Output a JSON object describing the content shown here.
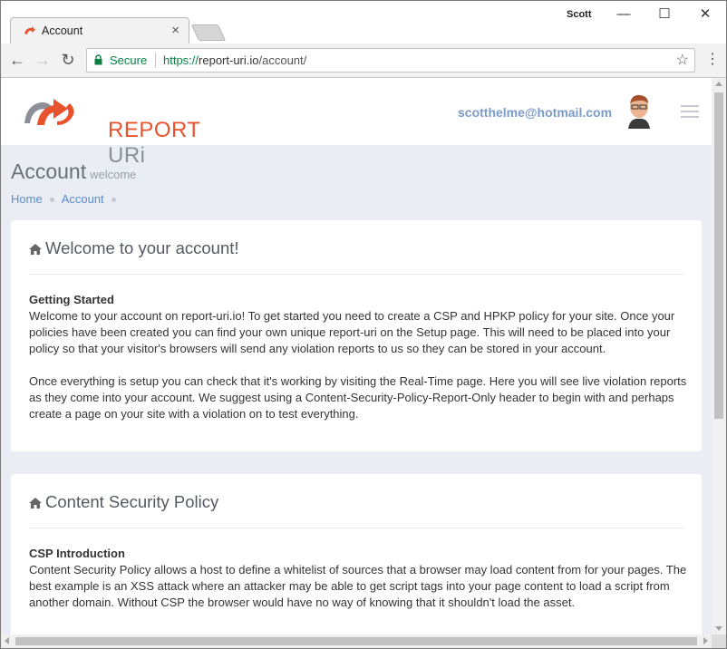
{
  "browser": {
    "tab_title": "Account",
    "tab_close": "×",
    "profile_name": "Scott",
    "minimize": "—",
    "maximize": "☐",
    "close": "✕",
    "secure_label": "Secure",
    "url_scheme": "https://",
    "url_domain": "report-uri.io",
    "url_path": "/account/",
    "back_glyph": "←",
    "forward_glyph": "→",
    "reload_glyph": "↻",
    "star_glyph": "☆",
    "menu_glyph": "⋮"
  },
  "site": {
    "logo_text_1": "REPORT ",
    "logo_text_2": "URi",
    "user_email": "scotthelme@hotmail.com"
  },
  "page": {
    "title": "Account",
    "subtitle": "welcome",
    "breadcrumb": [
      "Home",
      "Account"
    ]
  },
  "cards": [
    {
      "heading": "Welcome to your account!",
      "section_title": "Getting Started",
      "paragraphs": [
        "Welcome to your account on report-uri.io! To get started you need to create a CSP and HPKP policy for your site. Once your policies have been created you can find your own unique report-uri on the Setup page. This will need to be placed into your policy so that your visitor's browsers will send any violation reports to us so they can be stored in your account.",
        "Once everything is setup you can check that it's working by visiting the Real-Time page. Here you will see live violation reports as they come into your account. We suggest using a Content-Security-Policy-Report-Only header to begin with and perhaps create a page on your site with a violation on to test everything."
      ]
    },
    {
      "heading": "Content Security Policy",
      "section_title": "CSP Introduction",
      "paragraphs": [
        "Content Security Policy allows a host to define a whitelist of sources that a browser may load content from for your pages. The best example is an XSS attack where an attacker may be able to get script tags into your page content to load a script from another domain. Without CSP the browser would have no way of knowing that it shouldn't load the asset."
      ]
    }
  ],
  "colors": {
    "brand_orange": "#e8532e",
    "brand_grey": "#8a8f98",
    "link_blue": "#5d8ccb",
    "page_bg": "#eaedf3",
    "secure_green": "#0b8043"
  },
  "icons": [
    "report-uri-favicon-icon",
    "lock-icon",
    "star-icon",
    "home-icon",
    "hamburger-icon",
    "back-arrow-icon",
    "forward-arrow-icon",
    "reload-icon"
  ]
}
